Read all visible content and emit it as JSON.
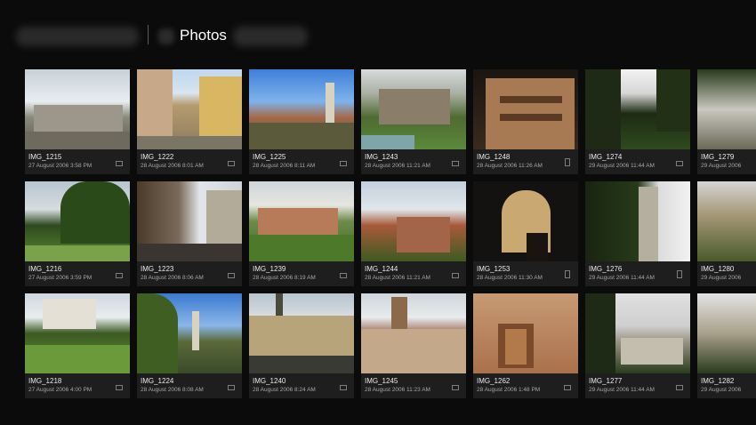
{
  "header": {
    "title": "Photos"
  },
  "photos": [
    {
      "name": "IMG_1215",
      "date": "27 August 2006 3:58 PM"
    },
    {
      "name": "IMG_1222",
      "date": "28 August 2006 8:01 AM"
    },
    {
      "name": "IMG_1225",
      "date": "28 August 2006 8:11 AM"
    },
    {
      "name": "IMG_1243",
      "date": "28 August 2006 11:21 AM"
    },
    {
      "name": "IMG_1248",
      "date": "28 August 2006 11:26 AM"
    },
    {
      "name": "IMG_1274",
      "date": "29 August 2006 11:44 AM"
    },
    {
      "name": "IMG_1279",
      "date": "29 August 2006"
    },
    {
      "name": "IMG_1216",
      "date": "27 August 2006 3:59 PM"
    },
    {
      "name": "IMG_1223",
      "date": "28 August 2006 8:06 AM"
    },
    {
      "name": "IMG_1239",
      "date": "28 August 2006 8:19 AM"
    },
    {
      "name": "IMG_1244",
      "date": "28 August 2006 11:21 AM"
    },
    {
      "name": "IMG_1253",
      "date": "28 August 2006 11:30 AM"
    },
    {
      "name": "IMG_1276",
      "date": "29 August 2006 11:44 AM"
    },
    {
      "name": "IMG_1280",
      "date": "29 August 2006"
    },
    {
      "name": "IMG_1218",
      "date": "27 August 2006 4:00 PM"
    },
    {
      "name": "IMG_1224",
      "date": "28 August 2006 8:08 AM"
    },
    {
      "name": "IMG_1240",
      "date": "28 August 2006 8:24 AM"
    },
    {
      "name": "IMG_1245",
      "date": "28 August 2006 11:23 AM"
    },
    {
      "name": "IMG_1262",
      "date": "28 August 2006 1:48 PM"
    },
    {
      "name": "IMG_1277",
      "date": "29 August 2006 11:44 AM"
    },
    {
      "name": "IMG_1282",
      "date": "29 August 2006"
    }
  ]
}
